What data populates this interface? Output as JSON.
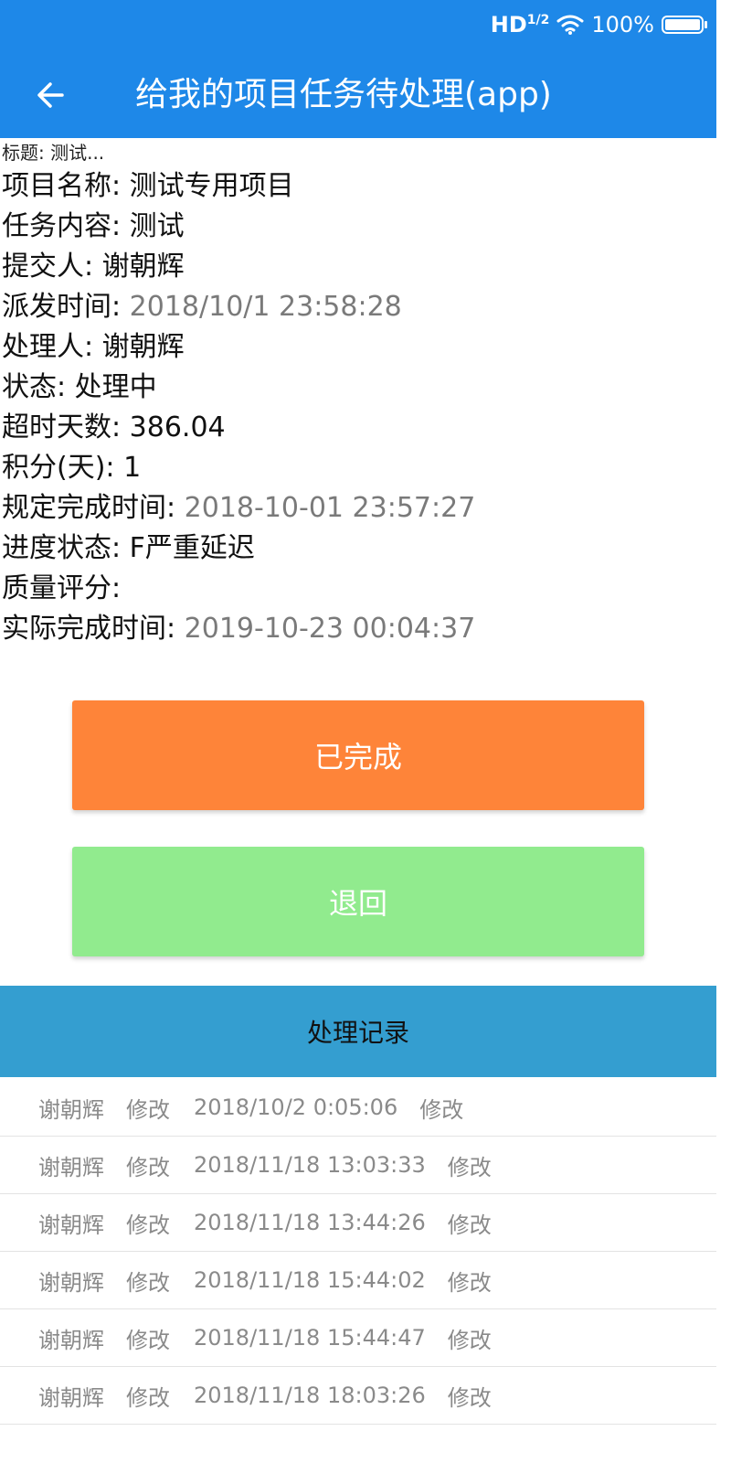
{
  "status_bar": {
    "signal": "HD",
    "signal_sub": "1/2",
    "battery": "100%",
    "icons": [
      "wifi-icon",
      "battery-icon"
    ]
  },
  "header": {
    "title": "给我的项目任务待处理(app)",
    "back_icon": "arrow-left-icon"
  },
  "detail": {
    "title_line": "标题: 测试...",
    "project_name_label": "项目名称: ",
    "project_name": "测试专用项目",
    "task_content_label": "任务内容: ",
    "task_content": "测试",
    "submitter_label": "提交人: ",
    "submitter": "谢朝辉",
    "dispatch_time_label": "派发时间: ",
    "dispatch_time": "2018/10/1 23:58:28",
    "handler_label": "处理人: ",
    "handler": "谢朝辉",
    "status_label": "状态: ",
    "status": "处理中",
    "overdue_days_label": "超时天数: ",
    "overdue_days": "386.04",
    "points_label": "积分(天): ",
    "points": "1",
    "deadline_label": "规定完成时间: ",
    "deadline": "2018-10-01 23:57:27",
    "progress_label": "进度状态: ",
    "progress": "F严重延迟",
    "quality_label": "质量评分:",
    "actual_finish_label": "实际完成时间: ",
    "actual_finish": "2019-10-23 00:04:37"
  },
  "actions": {
    "done_label": "已完成",
    "return_label": "退回"
  },
  "colors": {
    "header_bg": "#1e88e8",
    "done_bg": "#fe8439",
    "return_bg": "#91eb8e",
    "records_header_bg": "#349ed0"
  },
  "records": {
    "title": "处理记录",
    "rows": [
      {
        "user": "谢朝辉",
        "action": "修改",
        "time": "2018/10/2 0:05:06",
        "note": "修改"
      },
      {
        "user": "谢朝辉",
        "action": "修改",
        "time": "2018/11/18 13:03:33",
        "note": "修改"
      },
      {
        "user": "谢朝辉",
        "action": "修改",
        "time": "2018/11/18 13:44:26",
        "note": "修改"
      },
      {
        "user": "谢朝辉",
        "action": "修改",
        "time": "2018/11/18 15:44:02",
        "note": "修改"
      },
      {
        "user": "谢朝辉",
        "action": "修改",
        "time": "2018/11/18 15:44:47",
        "note": "修改"
      },
      {
        "user": "谢朝辉",
        "action": "修改",
        "time": "2018/11/18 18:03:26",
        "note": "修改"
      }
    ]
  }
}
